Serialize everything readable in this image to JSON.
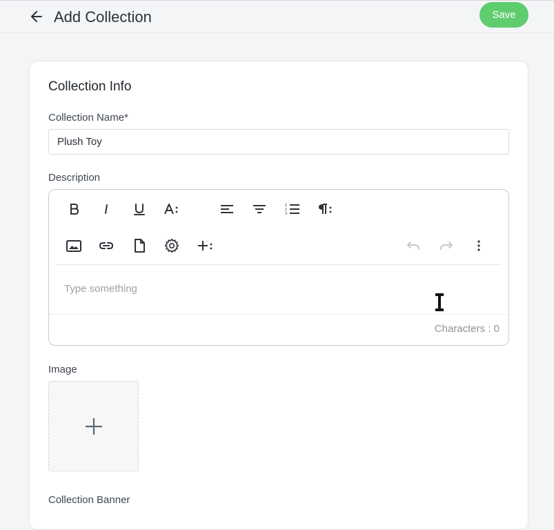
{
  "header": {
    "title": "Add Collection",
    "back_icon": "arrow-left-icon",
    "save_label": "Save"
  },
  "form": {
    "section_title": "Collection Info",
    "name_label": "Collection Name*",
    "name_value": "Plush Toy",
    "description_label": "Description",
    "editor": {
      "placeholder": "Type something",
      "char_count": "Characters : 0",
      "toolbar_row1": [
        "bold-icon",
        "italic-icon",
        "underline-icon",
        "font-size-icon",
        "align-left-icon",
        "align-center-icon",
        "ordered-list-icon",
        "paragraph-icon"
      ],
      "toolbar_row2": [
        "image-icon",
        "link-icon",
        "file-icon",
        "gear-icon",
        "insert-more-icon",
        "undo-icon",
        "redo-icon",
        "more-vertical-icon"
      ]
    },
    "image_label": "Image",
    "banner_label": "Collection Banner"
  },
  "colors": {
    "save_green": "#5fcd6e",
    "background": "#f4f5f7",
    "card": "#ffffff"
  }
}
